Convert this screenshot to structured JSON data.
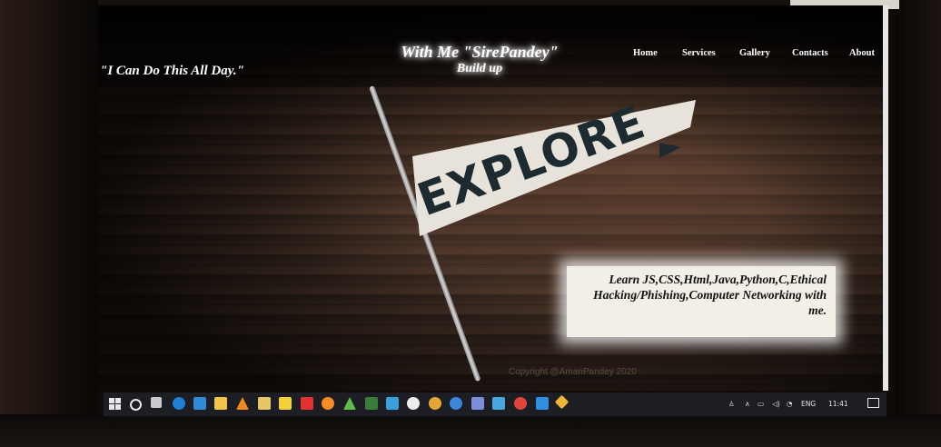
{
  "page": {
    "tagline": "\"I Can Do This All Day.\"",
    "brand_line1": "With Me \"SirePandey\"",
    "brand_line2": "Build up",
    "nav": [
      "Home",
      "Services",
      "Gallery",
      "Contacts",
      "About"
    ],
    "flag_text": "EXPLORE",
    "promo_text": "Learn JS,CSS,Html,Java,Python,C,Ethical Hacking/Phishing,Computer Networking with me.",
    "copyright": "Copyright @AmanPandey 2020"
  },
  "taskbar": {
    "icons": [
      "windows-start-icon",
      "cortana-search-icon",
      "task-view-icon",
      "edge-icon",
      "store-icon",
      "file-explorer-icon",
      "vlc-icon",
      "folder-icon",
      "bookmark-icon",
      "app-red-icon",
      "app-orange-icon",
      "app-green-icon",
      "app-n-icon",
      "app-blue-icon",
      "chrome-icon",
      "app-teal-icon",
      "app-purple-icon",
      "app-dark-icon",
      "opera-icon",
      "vscode-icon",
      "git-icon"
    ],
    "tray": {
      "language": "ENG",
      "time": "11:41"
    }
  }
}
